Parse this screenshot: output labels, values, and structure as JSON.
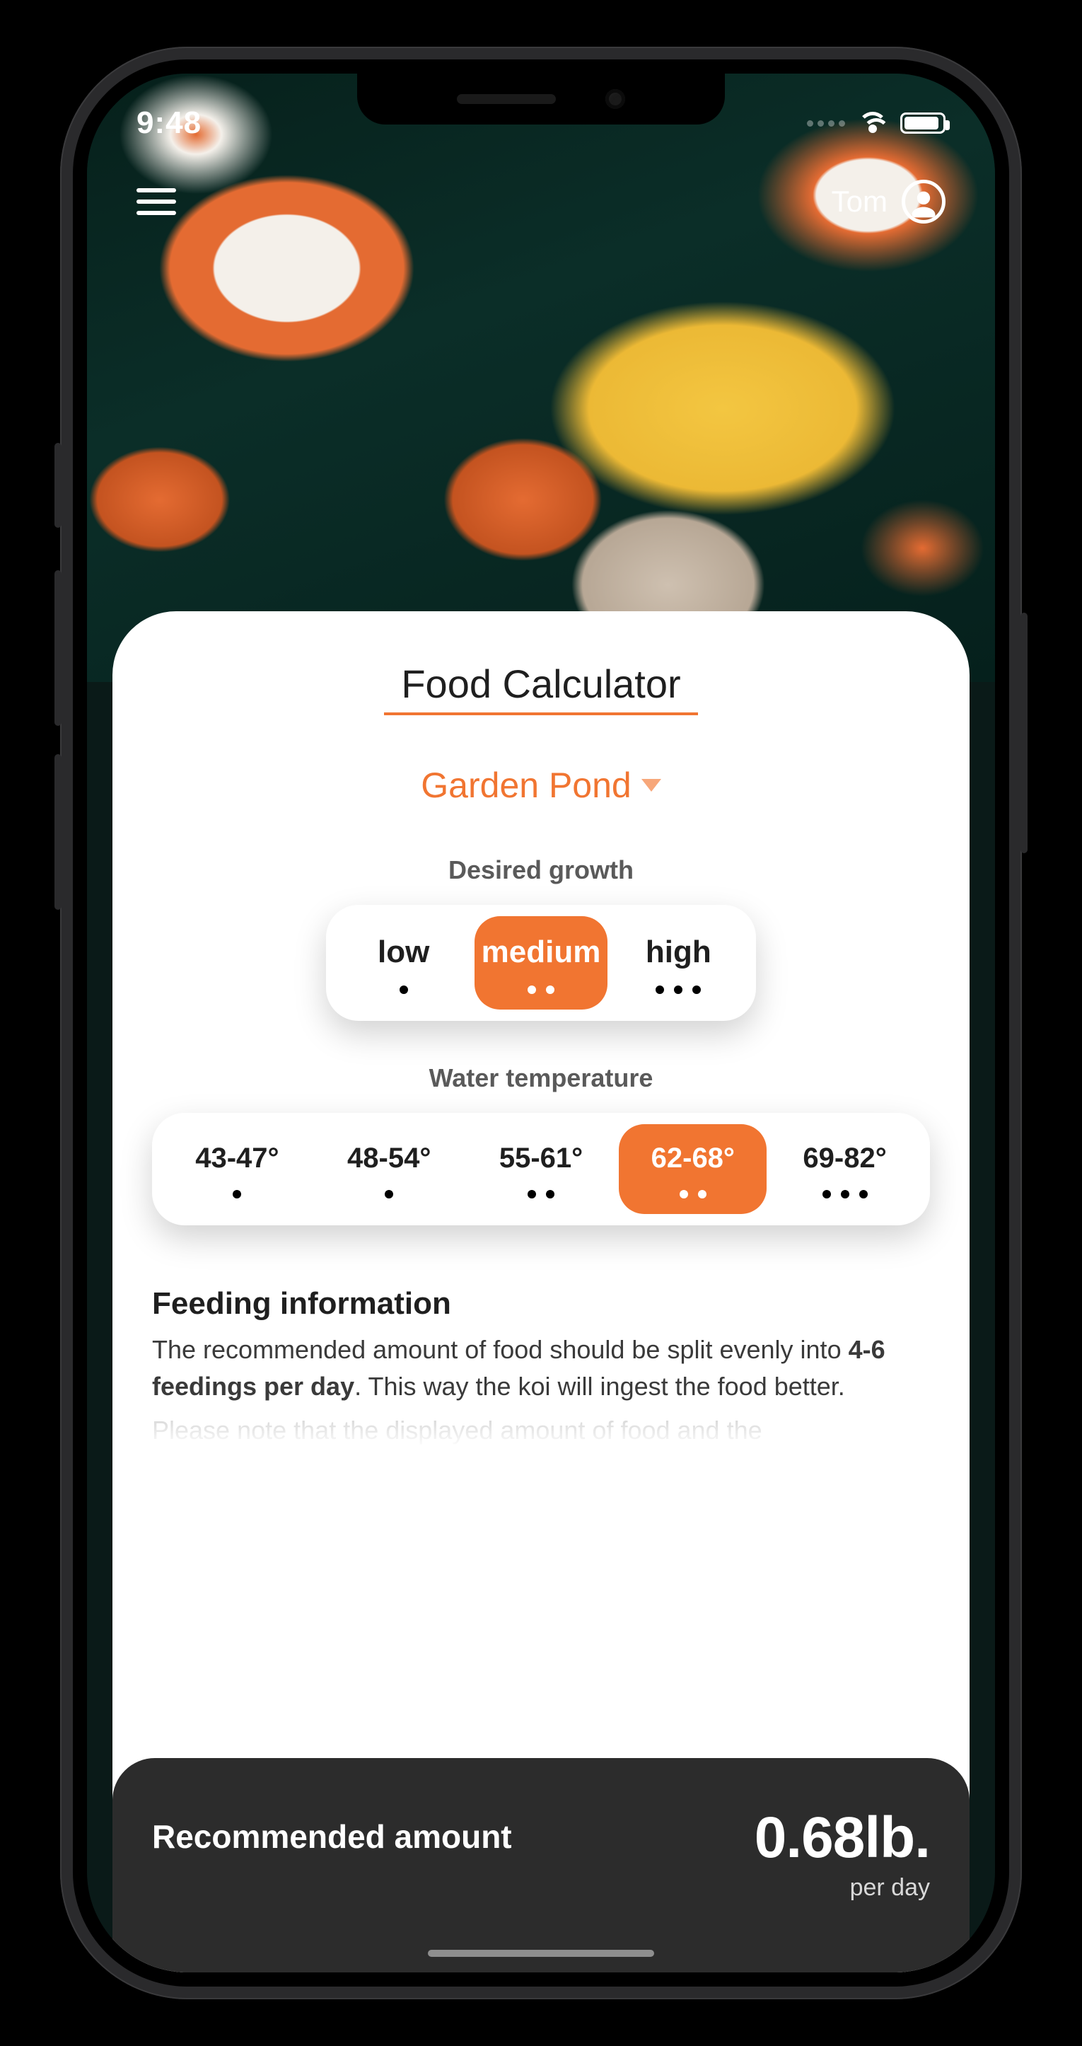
{
  "statusbar": {
    "time": "9:48"
  },
  "topbar": {
    "user_name": "Tom"
  },
  "page": {
    "title": "Food Calculator",
    "pond_selected": "Garden Pond"
  },
  "growth": {
    "label": "Desired growth",
    "options": [
      {
        "label": "low",
        "dots": 1,
        "active": false
      },
      {
        "label": "medium",
        "dots": 2,
        "active": true
      },
      {
        "label": "high",
        "dots": 3,
        "active": false
      }
    ]
  },
  "temperature": {
    "label": "Water temperature",
    "options": [
      {
        "label": "43-47°",
        "dots": 1,
        "active": false
      },
      {
        "label": "48-54°",
        "dots": 1,
        "active": false
      },
      {
        "label": "55-61°",
        "dots": 2,
        "active": false
      },
      {
        "label": "62-68°",
        "dots": 2,
        "active": true
      },
      {
        "label": "69-82°",
        "dots": 3,
        "active": false
      }
    ]
  },
  "info": {
    "heading": "Feeding information",
    "line1_a": "The recommended amount of food should be split evenly into ",
    "line1_bold": "4-6 feedings per day",
    "line1_b": ". This way the koi will ingest the food better.",
    "line2": "Please note that the displayed amount of food and the"
  },
  "result": {
    "label": "Recommended amount",
    "value": "0.68lb.",
    "unit": "per day"
  },
  "colors": {
    "accent": "#f17531"
  }
}
